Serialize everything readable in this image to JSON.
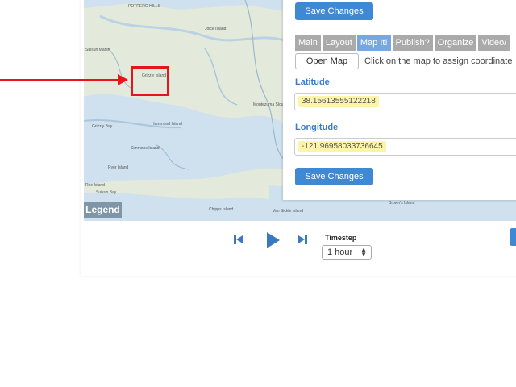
{
  "map": {
    "labels": [
      "POTRERO HILLS",
      "Grizzly Island",
      "Grizzly Bay",
      "Hammond Island",
      "Suisun Bay",
      "Simmons Island",
      "Ryer Island",
      "Roe Island",
      "Joice Island",
      "Chipps Island",
      "Montezuma Slough",
      "Suisun Marsh",
      "Van Sickle Island",
      "Brown's Island"
    ],
    "legend_label": "Legend"
  },
  "panel": {
    "save_top_label": "Save Changes",
    "tabs": [
      "Main",
      "Layout",
      "Map It!",
      "Publish?",
      "Organize",
      "Video/"
    ],
    "active_tab": "Map It!",
    "open_map_label": "Open Map",
    "hint_text": "Click on the map to assign coordinate",
    "latitude_label": "Latitude",
    "latitude_value": "38.15613555122218",
    "longitude_label": "Longitude",
    "longitude_value": "-121.96958033736645",
    "save_bottom_label": "Save Changes"
  },
  "playback": {
    "timestep_label": "Timestep",
    "timestep_value": "1 hour"
  },
  "colors": {
    "annotation_red": "#e8141b",
    "accent_blue": "#3f88d4",
    "highlight_yellow": "#fbf4a9"
  }
}
